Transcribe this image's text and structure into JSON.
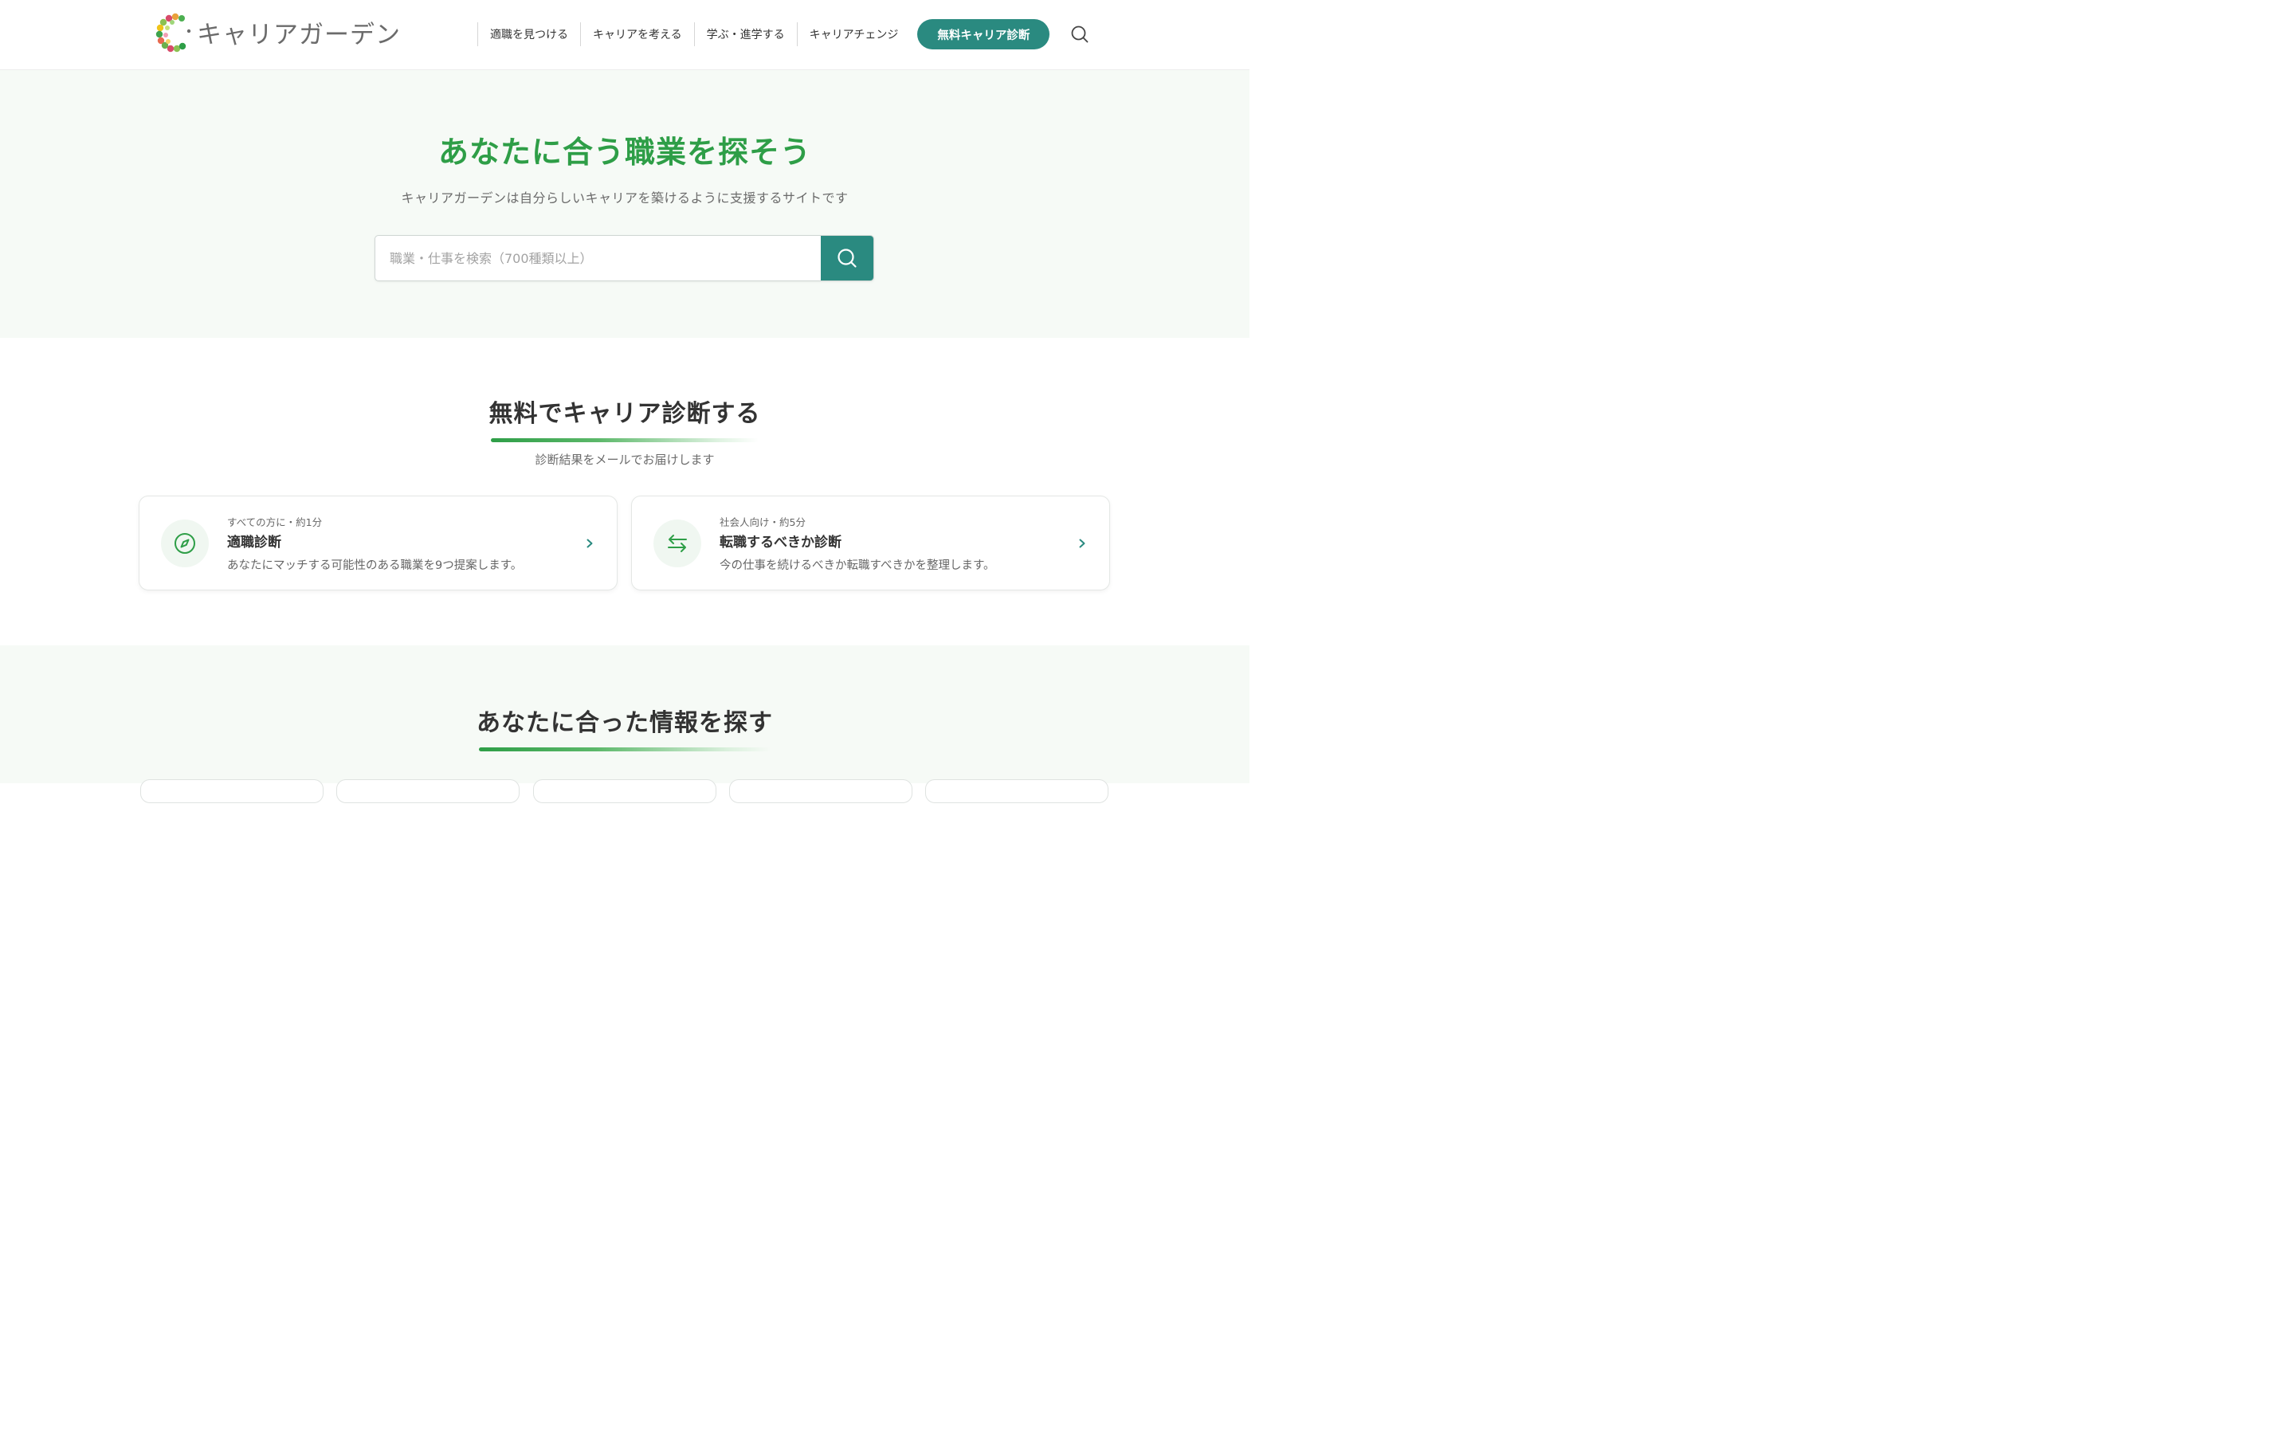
{
  "header": {
    "logo_text": "キャリアガーデン",
    "nav": [
      {
        "label": "適職を見つける"
      },
      {
        "label": "キャリアを考える"
      },
      {
        "label": "学ぶ・進学する"
      },
      {
        "label": "キャリアチェンジ"
      }
    ],
    "cta_label": "無料キャリア診断",
    "search_icon": "search-icon"
  },
  "hero": {
    "title": "あなたに合う職業を探そう",
    "subtitle": "キャリアガーデンは自分らしいキャリアを築けるように支援するサイトです",
    "search_placeholder": "職業・仕事を検索（700種類以上）",
    "search_value": ""
  },
  "diagnosis": {
    "title": "無料でキャリア診断する",
    "subtitle": "診断結果をメールでお届けします",
    "cards": [
      {
        "icon": "compass-icon",
        "meta": "すべての方に・約1分",
        "title": "適職診断",
        "description": "あなたにマッチする可能性のある職業を9つ提案します。"
      },
      {
        "icon": "arrows-exchange-icon",
        "meta": "社会人向け・約5分",
        "title": "転職するべきか診断",
        "description": "今の仕事を続けるべきか転職すべきかを整理します。"
      }
    ]
  },
  "info": {
    "title": "あなたに合った情報を探す"
  },
  "colors": {
    "brand_green": "#2e9e47",
    "teal": "#2a8a80",
    "hero_bg": "#f6faf6",
    "text": "#333333",
    "muted": "#6b6b6b"
  }
}
